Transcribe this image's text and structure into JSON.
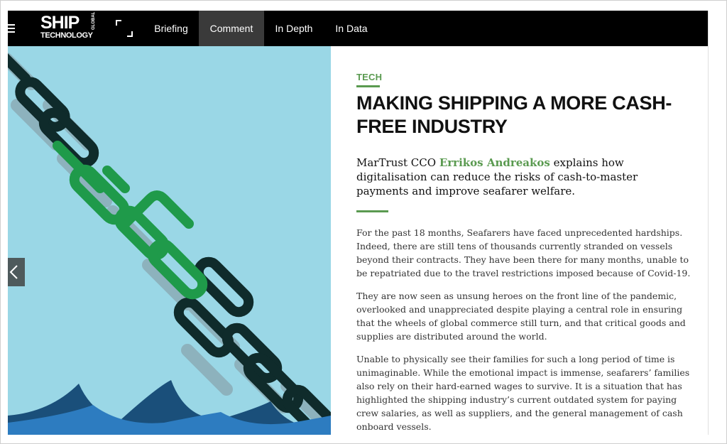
{
  "nav": {
    "logo": {
      "line1": "SHIP",
      "line2": "TECHNOLOGY",
      "side": "GLOBAL"
    },
    "tabs": [
      {
        "label": "Briefing",
        "active": false
      },
      {
        "label": "Comment",
        "active": true
      },
      {
        "label": "In Depth",
        "active": false
      },
      {
        "label": "In Data",
        "active": false
      }
    ],
    "icons": {
      "menu": "hamburger-menu-icon",
      "expand": "expand-icon"
    }
  },
  "hero": {
    "prev_icon": "chevron-left-icon"
  },
  "article": {
    "kicker": "TECH",
    "headline": "Making shipping a more cash-free industry",
    "standfirst": {
      "prefix": "MarTrust CCO ",
      "author": "Errikos Andreakos",
      "suffix": " explains how digitalisation can reduce the risks of cash-to-master payments and improve seafarer welfare."
    },
    "paragraphs": [
      "For the past 18 months, Seafarers have faced unprecedented hardships. Indeed, there are still tens of thousands currently stranded on vessels beyond their contracts. They have been there for many months, unable to be repatriated due to the travel restrictions imposed because of Covid-19.",
      "They are now seen as unsung heroes on the front line of the pandemic, overlooked and unappreciated despite playing a central role in ensuring that the wheels of global commerce still turn, and that critical goods and supplies are distributed around the world.",
      "Unable to physically see their families for such a long period of time is unimaginable. While the emotional impact is immense, seafarers’ families also rely on their hard-earned wages to survive. It is a situation that has highlighted the shipping industry’s current outdated system for paying crew salaries, as well as suppliers, and the general management of cash onboard vessels."
    ]
  },
  "colors": {
    "nav_bg": "#000000",
    "nav_active": "#3a3a3a",
    "accent_green": "#5a9a50",
    "hero_sky": "#9ad7e6",
    "chain_dark": "#0f2b2b",
    "chain_green": "#1f9a4a",
    "wave_dark": "#1a4f7a",
    "wave_light": "#2d7cc0"
  }
}
